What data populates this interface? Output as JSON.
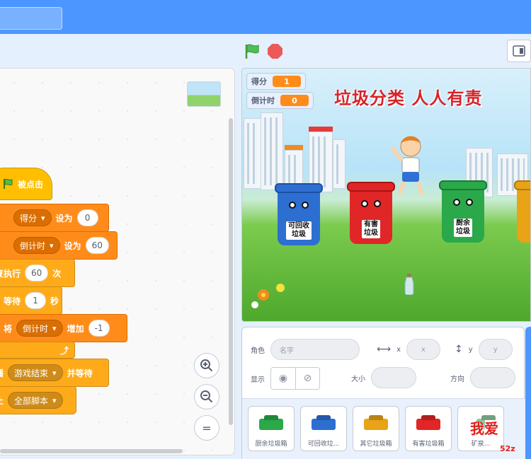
{
  "code_blocks": {
    "when_flag": "被点击",
    "set_score": {
      "var": "得分",
      "verb": "设为",
      "value": "0"
    },
    "set_timer": {
      "var": "倒计时",
      "verb": "设为",
      "value": "60"
    },
    "repeat": {
      "prefix": "复执行",
      "value": "60",
      "suffix": "次"
    },
    "wait": {
      "prefix": "等待",
      "value": "1",
      "suffix": "秒"
    },
    "change_timer": {
      "prefix": "将",
      "var": "倒计时",
      "verb": "增加",
      "value": "-1"
    },
    "broadcast": {
      "prefix": "播",
      "message": "游戏结束",
      "suffix": "并等待"
    },
    "stop": {
      "prefix": "止",
      "option": "全部脚本"
    }
  },
  "zoom": {
    "in": "+",
    "out": "−",
    "reset": "="
  },
  "stage": {
    "title": "垃圾分类 人人有责",
    "monitors": [
      {
        "label": "得分",
        "value": "1"
      },
      {
        "label": "倒计时",
        "value": "0"
      }
    ],
    "bins": [
      {
        "label_line1": "可回收",
        "label_line2": "垃圾",
        "color": "#2d6fd1"
      },
      {
        "label_line1": "有害",
        "label_line2": "垃圾",
        "color": "#e02626"
      },
      {
        "label_line1": "厨余",
        "label_line2": "垃圾",
        "color": "#2aa84a"
      }
    ]
  },
  "sprite_info": {
    "sprite_label": "角色",
    "sprite_name_placeholder": "名字",
    "x_label": "x",
    "x_placeholder": "x",
    "y_label": "y",
    "y_placeholder": "y",
    "show_label": "显示",
    "size_label": "大小",
    "direction_label": "方向"
  },
  "sprites": [
    {
      "name": "厨余垃圾箱",
      "color": "#2aa84a"
    },
    {
      "name": "可回收垃...",
      "color": "#2d6fd1"
    },
    {
      "name": "其它垃圾箱",
      "color": "#e8a317"
    },
    {
      "name": "有害垃圾箱",
      "color": "#e02626"
    },
    {
      "name": "矿泉...",
      "color": "#8fc7a0"
    }
  ],
  "watermark": {
    "main": "我爱",
    "sub": "52z"
  }
}
